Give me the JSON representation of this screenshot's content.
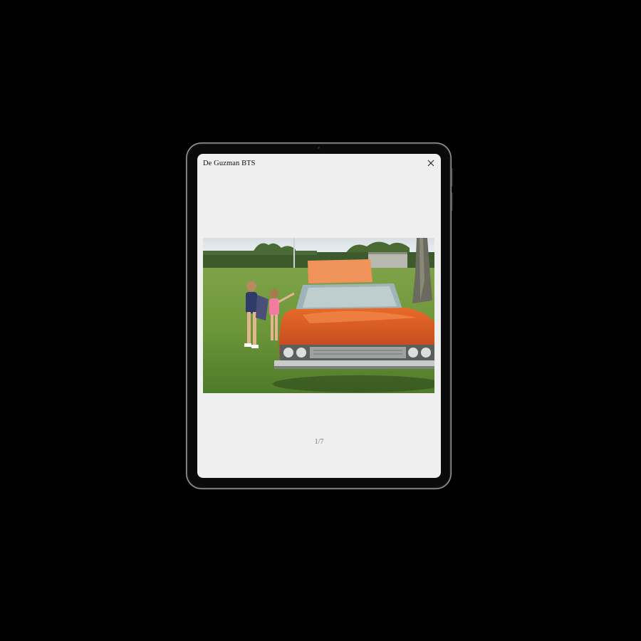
{
  "gallery": {
    "title": "De Guzman BTS",
    "counter": "1/7",
    "close_icon": "close-icon"
  },
  "photo": {
    "subject": "orange-classic-convertible-with-children-on-grass",
    "colors": {
      "car": "#d9571f",
      "grass": "#6f9a3c",
      "sky": "#dfe6ec",
      "hedge": "#3d5a2a"
    }
  }
}
